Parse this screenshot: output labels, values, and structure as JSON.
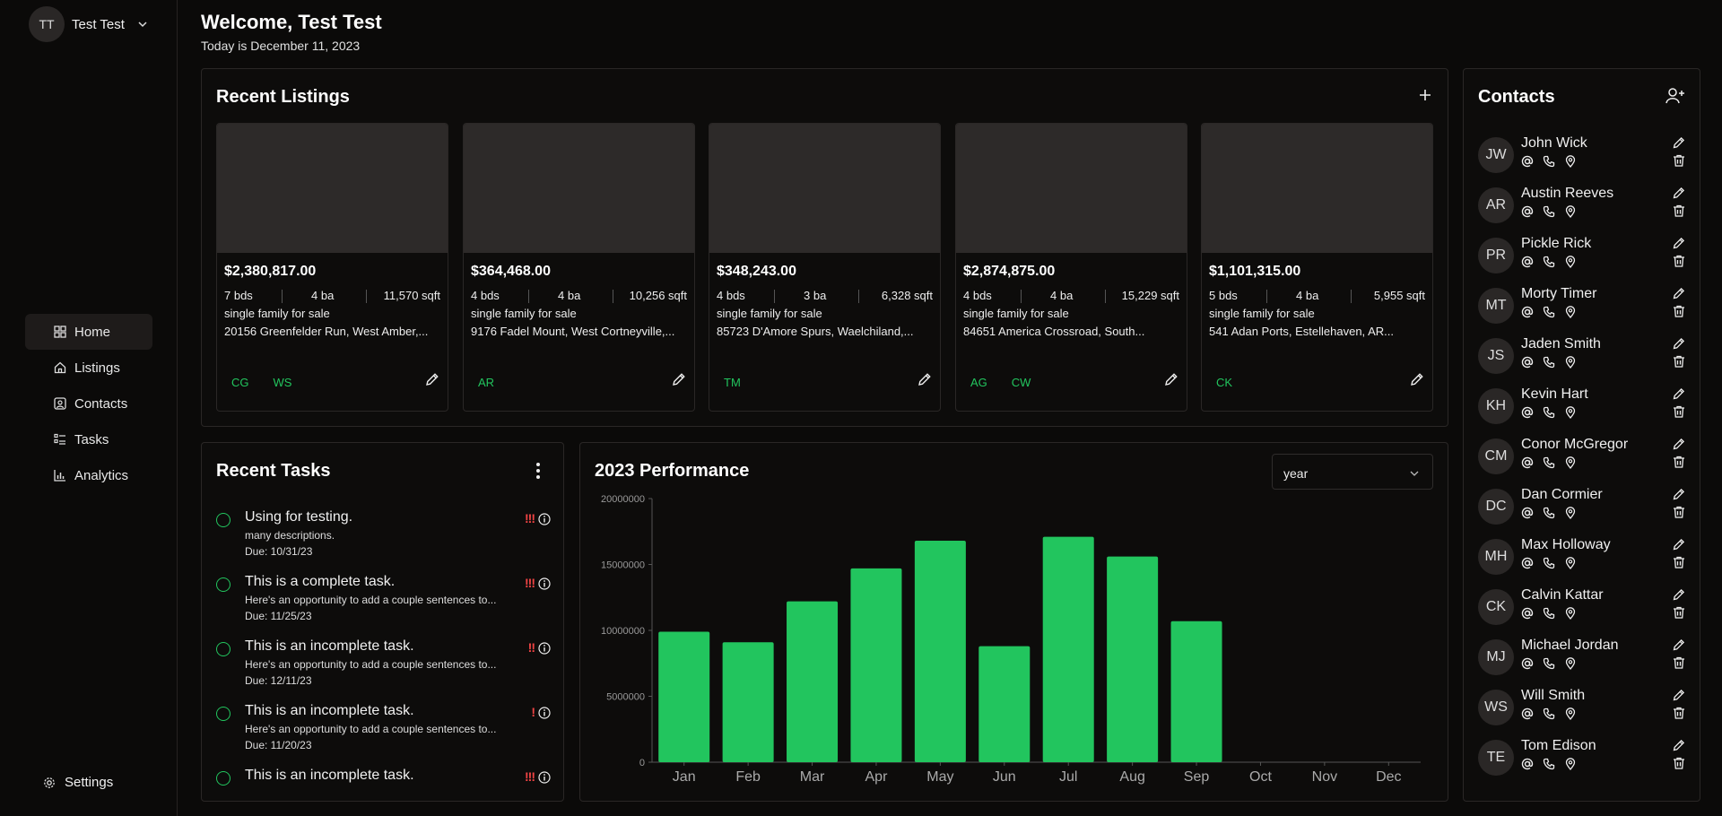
{
  "user": {
    "initials": "TT",
    "name": "Test Test"
  },
  "nav": [
    {
      "label": "Home",
      "icon": "home-grid-icon",
      "active": true
    },
    {
      "label": "Listings",
      "icon": "house-icon"
    },
    {
      "label": "Contacts",
      "icon": "contact-card-icon"
    },
    {
      "label": "Tasks",
      "icon": "list-check-icon"
    },
    {
      "label": "Analytics",
      "icon": "bar-chart-icon"
    }
  ],
  "settings_label": "Settings",
  "header": {
    "welcome": "Welcome, Test Test",
    "today": "Today is December 11, 2023"
  },
  "listings": {
    "title": "Recent Listings",
    "items": [
      {
        "price": "$2,380,817.00",
        "bds": "7 bds",
        "ba": "4 ba",
        "sqft": "11,570 sqft",
        "type": "single family for sale",
        "address": "20156 Greenfelder Run, West Amber,...",
        "agents": [
          "CG",
          "WS"
        ]
      },
      {
        "price": "$364,468.00",
        "bds": "4 bds",
        "ba": "4 ba",
        "sqft": "10,256 sqft",
        "type": "single family for sale",
        "address": "9176 Fadel Mount, West Cortneyville,...",
        "agents": [
          "AR"
        ]
      },
      {
        "price": "$348,243.00",
        "bds": "4 bds",
        "ba": "3 ba",
        "sqft": "6,328 sqft",
        "type": "single family for sale",
        "address": "85723 D'Amore Spurs, Waelchiland,...",
        "agents": [
          "TM"
        ]
      },
      {
        "price": "$2,874,875.00",
        "bds": "4 bds",
        "ba": "4 ba",
        "sqft": "15,229 sqft",
        "type": "single family for sale",
        "address": "84651 America Crossroad, South...",
        "agents": [
          "AG",
          "CW"
        ]
      },
      {
        "price": "$1,101,315.00",
        "bds": "5 bds",
        "ba": "4 ba",
        "sqft": "5,955 sqft",
        "type": "single family for sale",
        "address": "541 Adan Ports, Estellehaven, AR...",
        "agents": [
          "CK"
        ]
      }
    ]
  },
  "tasks": {
    "title": "Recent Tasks",
    "items": [
      {
        "title": "Using for testing.",
        "desc": "many descriptions.",
        "due": "Due: 10/31/23",
        "priority": "!!!"
      },
      {
        "title": "This is a complete task.",
        "desc": "Here's an opportunity to add a couple sentences to...",
        "due": "Due: 11/25/23",
        "priority": "!!!"
      },
      {
        "title": "This is an incomplete task.",
        "desc": "Here's an opportunity to add a couple sentences to...",
        "due": "Due: 12/11/23",
        "priority": "!!"
      },
      {
        "title": "This is an incomplete task.",
        "desc": "Here's an opportunity to add a couple sentences to...",
        "due": "Due: 11/20/23",
        "priority": "!"
      },
      {
        "title": "This is an incomplete task.",
        "desc": "",
        "due": "",
        "priority": "!!!"
      }
    ]
  },
  "performance": {
    "title": "2023 Performance",
    "select_value": "year",
    "chart_data": {
      "type": "bar",
      "categories": [
        "Jan",
        "Feb",
        "Mar",
        "Apr",
        "May",
        "Jun",
        "Jul",
        "Aug",
        "Sep",
        "Oct",
        "Nov",
        "Dec"
      ],
      "values": [
        9900000,
        9100000,
        12200000,
        14700000,
        16800000,
        8800000,
        17100000,
        15600000,
        10700000,
        0,
        0,
        0
      ],
      "ylim": [
        0,
        20000000
      ],
      "yticks": [
        "0",
        "5000000",
        "10000000",
        "15000000",
        "20000000"
      ],
      "bar_color": "#22c55e",
      "grid": false
    }
  },
  "contacts": {
    "title": "Contacts",
    "items": [
      {
        "initials": "JW",
        "name": "John Wick"
      },
      {
        "initials": "AR",
        "name": "Austin Reeves"
      },
      {
        "initials": "PR",
        "name": "Pickle Rick"
      },
      {
        "initials": "MT",
        "name": "Morty Timer"
      },
      {
        "initials": "JS",
        "name": "Jaden Smith"
      },
      {
        "initials": "KH",
        "name": "Kevin Hart"
      },
      {
        "initials": "CM",
        "name": "Conor McGregor"
      },
      {
        "initials": "DC",
        "name": "Dan Cormier"
      },
      {
        "initials": "MH",
        "name": "Max Holloway"
      },
      {
        "initials": "CK",
        "name": "Calvin Kattar"
      },
      {
        "initials": "MJ",
        "name": "Michael Jordan"
      },
      {
        "initials": "WS",
        "name": "Will Smith"
      },
      {
        "initials": "TE",
        "name": "Tom Edison"
      }
    ]
  },
  "colors": {
    "accent": "#22c55e",
    "priority": "#ef4444",
    "background": "#0b0a09",
    "card_image": "#2d2a29"
  }
}
